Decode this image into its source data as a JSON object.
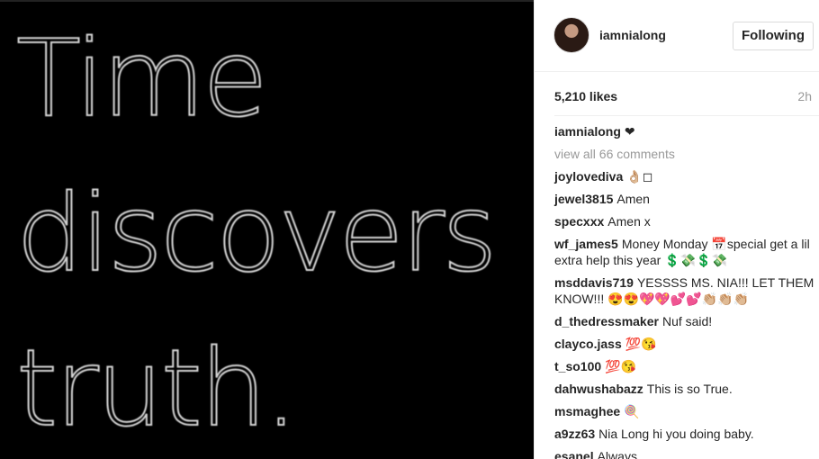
{
  "photo": {
    "lines": [
      "Time",
      "discovers",
      "truth."
    ]
  },
  "post": {
    "username": "iamnialong",
    "follow_label": "Following",
    "likes": "5,210 likes",
    "time": "2h"
  },
  "caption": {
    "user": "iamnialong",
    "text": "❤"
  },
  "view_all": "view all 66 comments",
  "comments": [
    {
      "user": "joylovediva",
      "text": "👌🏼◻"
    },
    {
      "user": "jewel3815",
      "text": "Amen"
    },
    {
      "user": "specxxx",
      "text": "Amen x"
    },
    {
      "user": "wf_james5",
      "text": "Money Monday 📅special get a lil extra help this year 💲💸💲💸"
    },
    {
      "user": "msddavis719",
      "text": "YESSSS MS. NIA!!! LET THEM KNOW!!! 😍😍💖💖💕💕👏🏼👏🏼👏🏼"
    },
    {
      "user": "d_thedressmaker",
      "text": "Nuf said!"
    },
    {
      "user": "clayco.jass",
      "text": "💯😘"
    },
    {
      "user": "t_so100",
      "text": "💯😘"
    },
    {
      "user": "dahwushabazz",
      "text": "This is so True."
    },
    {
      "user": "msmaghee",
      "text": "🍭"
    },
    {
      "user": "a9zz63",
      "text": "Nia Long hi you doing baby."
    },
    {
      "user": "esanel",
      "text": "Always"
    }
  ]
}
